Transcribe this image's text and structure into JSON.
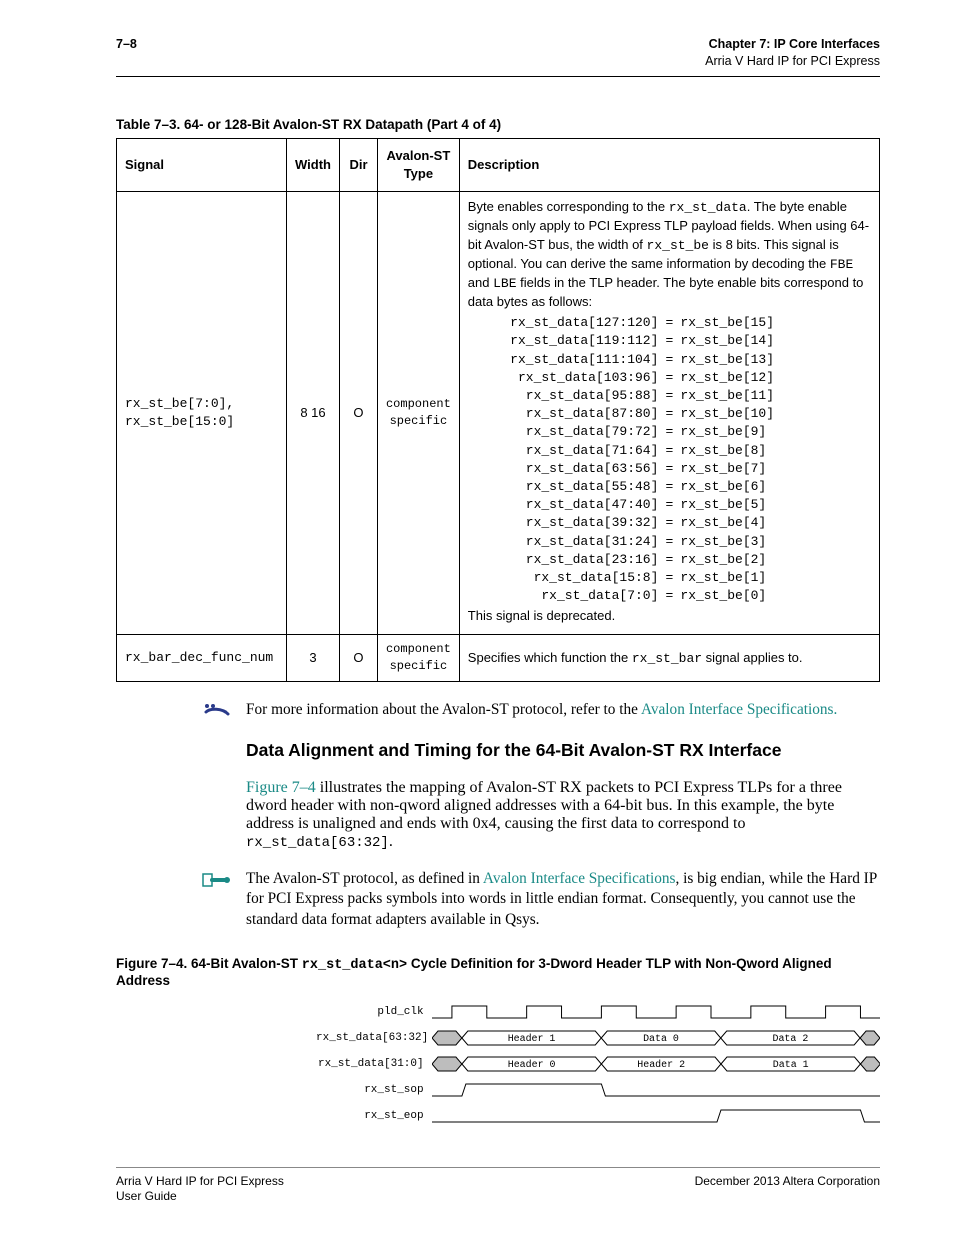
{
  "header": {
    "page_number": "7–8",
    "chapter_line": "Chapter 7: IP Core Interfaces",
    "sub_line": "Arria V Hard IP for PCI Express"
  },
  "table": {
    "caption": "Table 7–3.  64- or 128-Bit Avalon-ST RX Datapath   (Part 4 of 4)",
    "columns": {
      "signal": "Signal",
      "width": "Width",
      "dir": "Dir",
      "avtype": "Avalon-ST Type",
      "desc": "Description"
    },
    "rows": [
      {
        "signal": "rx_st_be[7:0], rx_st_be[15:0]",
        "width": "8 16",
        "dir": "O",
        "avtype": "component specific",
        "desc_lead": "Byte enables corresponding to the ",
        "desc_mono1": "rx_st_data",
        "desc_after1": ". The byte enable signals only apply to PCI Express TLP payload fields. When using 64-bit Avalon-ST bus, the width of ",
        "desc_mono2": "rx_st_be",
        "desc_after2": " is 8 bits. This signal is optional. You can derive the same information by decoding the ",
        "desc_mono3": "FBE",
        "desc_mid": " and ",
        "desc_mono4": "LBE",
        "desc_tail": " fields in the TLP header. The byte enable bits correspond to data bytes as follows:",
        "mappings": [
          {
            "lhs": "rx_st_data[127:120]",
            "rhs": "rx_st_be[15]"
          },
          {
            "lhs": "rx_st_data[119:112]",
            "rhs": "rx_st_be[14]"
          },
          {
            "lhs": "rx_st_data[111:104]",
            "rhs": "rx_st_be[13]"
          },
          {
            "lhs": "rx_st_data[103:96]",
            "rhs": "rx_st_be[12]"
          },
          {
            "lhs": "rx_st_data[95:88]",
            "rhs": "rx_st_be[11]"
          },
          {
            "lhs": "rx_st_data[87:80]",
            "rhs": "rx_st_be[10]"
          },
          {
            "lhs": "rx_st_data[79:72]",
            "rhs": "rx_st_be[9]"
          },
          {
            "lhs": "rx_st_data[71:64]",
            "rhs": "rx_st_be[8]"
          },
          {
            "lhs": "rx_st_data[63:56]",
            "rhs": "rx_st_be[7]"
          },
          {
            "lhs": "rx_st_data[55:48]",
            "rhs": "rx_st_be[6]"
          },
          {
            "lhs": "rx_st_data[47:40]",
            "rhs": "rx_st_be[5]"
          },
          {
            "lhs": "rx_st_data[39:32]",
            "rhs": "rx_st_be[4]"
          },
          {
            "lhs": "rx_st_data[31:24]",
            "rhs": "rx_st_be[3]"
          },
          {
            "lhs": "rx_st_data[23:16]",
            "rhs": "rx_st_be[2]"
          },
          {
            "lhs": "rx_st_data[15:8]",
            "rhs": "rx_st_be[1]"
          },
          {
            "lhs": "rx_st_data[7:0]",
            "rhs": "rx_st_be[0]"
          }
        ],
        "desc_last": "This signal is deprecated."
      },
      {
        "signal": "rx_bar_dec_func_num",
        "width": "3",
        "dir": "O",
        "avtype": "component specific",
        "desc_a": "Specifies which function the ",
        "desc_mono": "rx_st_bar",
        "desc_b": " signal applies to."
      }
    ]
  },
  "ref_para": {
    "pre": "For more information about the Avalon-ST protocol, refer to the ",
    "link": "Avalon Interface Specifications.",
    "post": ""
  },
  "subhead": "Data Alignment and Timing for the 64-Bit Avalon-ST RX Interface",
  "para7_4": {
    "linkref": "Figure 7–4",
    "after": " illustrates the mapping of Avalon-ST RX packets to PCI Express TLPs for a three dword header with non-qword aligned addresses with a 64-bit bus. In this example, the byte address is unaligned and ends with 0x4, causing the first data to correspond to ",
    "mono": "rx_st_data[63:32]",
    "tail": "."
  },
  "note_para": {
    "pre": "The Avalon-ST protocol, as defined in ",
    "link": "Avalon Interface Specifications",
    "post": ", is big endian, while the Hard IP for PCI Express packs symbols into words in little endian format. Consequently, you cannot use the standard data format adapters available in Qsys."
  },
  "figure": {
    "caption_a": "Figure 7–4.  64-Bit Avalon-ST ",
    "caption_mono": "rx_st_data<n>",
    "caption_b": " Cycle Definition for 3-Dword Header TLP with Non-Qword Aligned Address",
    "lanes": {
      "clk": "pld_clk",
      "d63": "rx_st_data[63:32]",
      "d31": "rx_st_data[31:0]",
      "sop": "rx_st_sop",
      "eop": "rx_st_eop"
    },
    "cells": {
      "d63": [
        "Header 1",
        "Data 0",
        "Data 2"
      ],
      "d31": [
        "Header 0",
        "Header 2",
        "Data 1"
      ]
    }
  },
  "footer": {
    "left1": "Arria V Hard IP for PCI Express",
    "left2": "User Guide",
    "right": "December 2013   Altera Corporation"
  }
}
